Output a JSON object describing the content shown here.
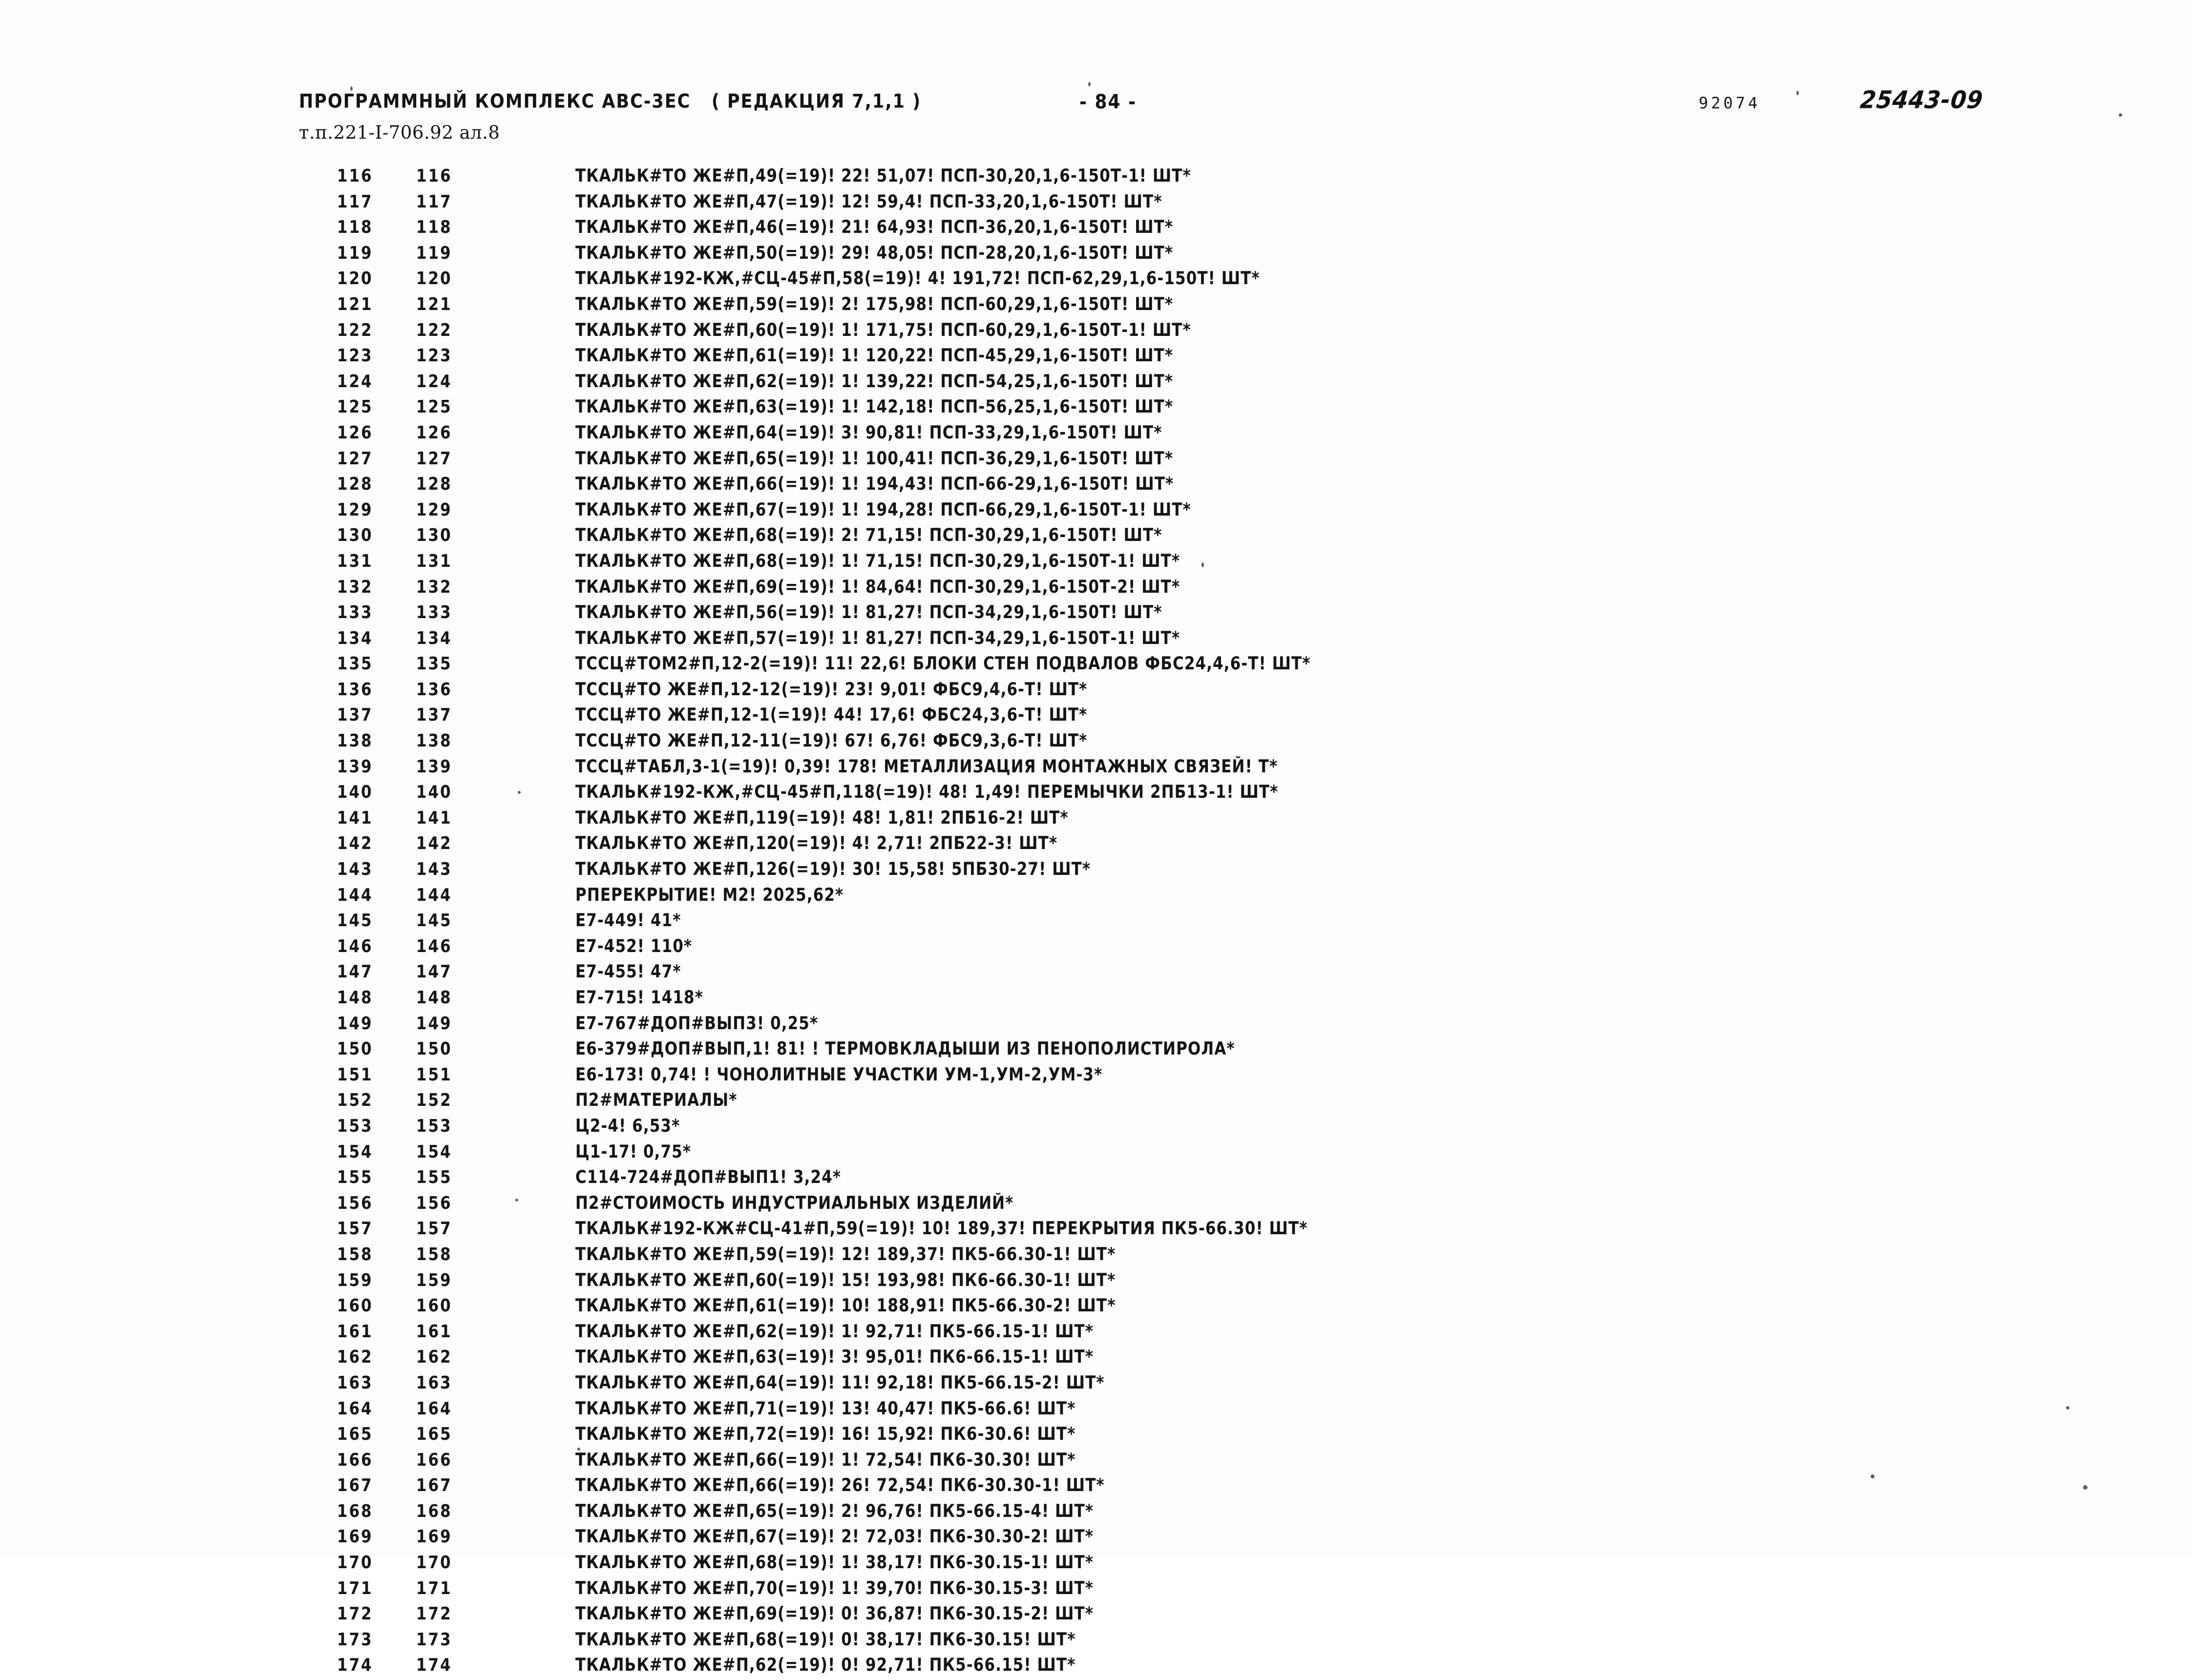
{
  "header": {
    "program_title": "ПРОГРАММНЫЙ КОМПЛЕКС АВС-3ЕС   ( РЕДАКЦИЯ 7,1,1 )",
    "page_number": "- 84 -",
    "document_code": "т.п.221-I-706.92 ал.8",
    "stamp_number": "92074",
    "stamp_code": "25443-09"
  },
  "listing": {
    "rows": [
      {
        "a": "116",
        "b": "116",
        "text": "ТКАЛЬК#ТО ЖЕ#П,49(=19)! 22! 51,07! ПСП-30,20,1,6-150Т-1! ШТ*"
      },
      {
        "a": "117",
        "b": "117",
        "text": "ТКАЛЬК#ТО ЖЕ#П,47(=19)! 12! 59,4! ПСП-33,20,1,6-150Т! ШТ*"
      },
      {
        "a": "118",
        "b": "118",
        "text": "ТКАЛЬК#ТО ЖЕ#П,46(=19)! 21! 64,93! ПСП-36,20,1,6-150Т! ШТ*"
      },
      {
        "a": "119",
        "b": "119",
        "text": "ТКАЛЬК#ТО ЖЕ#П,50(=19)! 29! 48,05! ПСП-28,20,1,6-150Т! ШТ*"
      },
      {
        "a": "120",
        "b": "120",
        "text": "ТКАЛЬК#192-КЖ,#СЦ-45#П,58(=19)! 4! 191,72! ПСП-62,29,1,6-150Т! ШТ*"
      },
      {
        "a": "121",
        "b": "121",
        "text": "ТКАЛЬК#ТО ЖЕ#П,59(=19)! 2! 175,98! ПСП-60,29,1,6-150Т! ШТ*"
      },
      {
        "a": "122",
        "b": "122",
        "text": "ТКАЛЬК#ТО ЖЕ#П,60(=19)! 1! 171,75! ПСП-60,29,1,6-150Т-1! ШТ*"
      },
      {
        "a": "123",
        "b": "123",
        "text": "ТКАЛЬК#ТО ЖЕ#П,61(=19)! 1! 120,22! ПСП-45,29,1,6-150Т! ШТ*"
      },
      {
        "a": "124",
        "b": "124",
        "text": "ТКАЛЬК#ТО ЖЕ#П,62(=19)! 1! 139,22! ПСП-54,25,1,6-150Т! ШТ*"
      },
      {
        "a": "125",
        "b": "125",
        "text": "ТКАЛЬК#ТО ЖЕ#П,63(=19)! 1! 142,18! ПСП-56,25,1,6-150Т! ШТ*"
      },
      {
        "a": "126",
        "b": "126",
        "text": "ТКАЛЬК#ТО ЖЕ#П,64(=19)! 3! 90,81! ПСП-33,29,1,6-150Т! ШТ*"
      },
      {
        "a": "127",
        "b": "127",
        "text": "ТКАЛЬК#ТО ЖЕ#П,65(=19)! 1! 100,41! ПСП-36,29,1,6-150Т! ШТ*"
      },
      {
        "a": "128",
        "b": "128",
        "text": "ТКАЛЬК#ТО ЖЕ#П,66(=19)! 1! 194,43! ПСП-66-29,1,6-150Т! ШТ*"
      },
      {
        "a": "129",
        "b": "129",
        "text": "ТКАЛЬК#ТО ЖЕ#П,67(=19)! 1! 194,28! ПСП-66,29,1,6-150Т-1! ШТ*"
      },
      {
        "a": "130",
        "b": "130",
        "text": "ТКАЛЬК#ТО ЖЕ#П,68(=19)! 2! 71,15! ПСП-30,29,1,6-150Т! ШТ*"
      },
      {
        "a": "131",
        "b": "131",
        "text": "ТКАЛЬК#ТО ЖЕ#П,68(=19)! 1! 71,15! ПСП-30,29,1,6-150Т-1! ШТ*"
      },
      {
        "a": "132",
        "b": "132",
        "text": "ТКАЛЬК#ТО ЖЕ#П,69(=19)! 1! 84,64! ПСП-30,29,1,6-150Т-2! ШТ*"
      },
      {
        "a": "133",
        "b": "133",
        "text": "ТКАЛЬК#ТО ЖЕ#П,56(=19)! 1! 81,27! ПСП-34,29,1,6-150Т! ШТ*"
      },
      {
        "a": "134",
        "b": "134",
        "text": "ТКАЛЬК#ТО ЖЕ#П,57(=19)! 1! 81,27! ПСП-34,29,1,6-150Т-1! ШТ*"
      },
      {
        "a": "135",
        "b": "135",
        "text": "ТССЦ#ТОМ2#П,12-2(=19)! 11! 22,6! БЛОКИ СТЕН ПОДВАЛОВ ФБС24,4,6-Т! ШТ*"
      },
      {
        "a": "136",
        "b": "136",
        "text": "ТССЦ#ТО ЖЕ#П,12-12(=19)! 23! 9,01! ФБС9,4,6-Т! ШТ*"
      },
      {
        "a": "137",
        "b": "137",
        "text": "ТССЦ#ТО ЖЕ#П,12-1(=19)! 44! 17,6! ФБС24,3,6-Т! ШТ*"
      },
      {
        "a": "138",
        "b": "138",
        "text": "ТССЦ#ТО ЖЕ#П,12-11(=19)! 67! 6,76! ФБС9,3,6-Т! ШТ*"
      },
      {
        "a": "139",
        "b": "139",
        "text": "ТССЦ#ТАБЛ,3-1(=19)! 0,39! 178! МЕТАЛЛИЗАЦИЯ МОНТАЖНЫХ СВЯЗЕЙ! Т*"
      },
      {
        "a": "140",
        "b": "140",
        "text": "ТКАЛЬК#192-КЖ,#СЦ-45#П,118(=19)! 48! 1,49! ПЕРЕМЫЧКИ 2ПБ13-1! ШТ*"
      },
      {
        "a": "141",
        "b": "141",
        "text": "ТКАЛЬК#ТО ЖЕ#П,119(=19)! 48! 1,81! 2ПБ16-2! ШТ*"
      },
      {
        "a": "142",
        "b": "142",
        "text": "ТКАЛЬК#ТО ЖЕ#П,120(=19)! 4! 2,71! 2ПБ22-3! ШТ*"
      },
      {
        "a": "143",
        "b": "143",
        "text": "ТКАЛЬК#ТО ЖЕ#П,126(=19)! 30! 15,58! 5ПБ30-27! ШТ*"
      },
      {
        "a": "144",
        "b": "144",
        "text": "РПЕРЕКРЫТИЕ! М2! 2025,62*"
      },
      {
        "a": "145",
        "b": "145",
        "text": "Е7-449! 41*"
      },
      {
        "a": "146",
        "b": "146",
        "text": "Е7-452! 110*"
      },
      {
        "a": "147",
        "b": "147",
        "text": "Е7-455! 47*"
      },
      {
        "a": "148",
        "b": "148",
        "text": "Е7-715! 1418*"
      },
      {
        "a": "149",
        "b": "149",
        "text": "Е7-767#ДОП#ВЫП3! 0,25*"
      },
      {
        "a": "150",
        "b": "150",
        "text": "Е6-379#ДОП#ВЫП,1! 81! ! ТЕРМОВКЛАДЫШИ ИЗ ПЕНОПОЛИСТИРОЛА*"
      },
      {
        "a": "151",
        "b": "151",
        "text": "Е6-173! 0,74! ! ЧОНОЛИТНЫЕ УЧАСТКИ УМ-1,УМ-2,УМ-3*"
      },
      {
        "a": "152",
        "b": "152",
        "text": "П2#МАТЕРИАЛЫ*"
      },
      {
        "a": "153",
        "b": "153",
        "text": "Ц2-4! 6,53*"
      },
      {
        "a": "154",
        "b": "154",
        "text": "Ц1-17! 0,75*"
      },
      {
        "a": "155",
        "b": "155",
        "text": "С114-724#ДОП#ВЫП1! 3,24*"
      },
      {
        "a": "156",
        "b": "156",
        "text": "П2#СТОИМОСТЬ ИНДУСТРИАЛЬНЫХ ИЗДЕЛИЙ*"
      },
      {
        "a": "157",
        "b": "157",
        "text": "ТКАЛЬК#192-КЖ#СЦ-41#П,59(=19)! 10! 189,37! ПЕРЕКРЫТИЯ ПК5-66.30! ШТ*"
      },
      {
        "a": "158",
        "b": "158",
        "text": "ТКАЛЬК#ТО ЖЕ#П,59(=19)! 12! 189,37! ПК5-66.30-1! ШТ*"
      },
      {
        "a": "159",
        "b": "159",
        "text": "ТКАЛЬК#ТО ЖЕ#П,60(=19)! 15! 193,98! ПК6-66.30-1! ШТ*"
      },
      {
        "a": "160",
        "b": "160",
        "text": "ТКАЛЬК#ТО ЖЕ#П,61(=19)! 10! 188,91! ПК5-66.30-2! ШТ*"
      },
      {
        "a": "161",
        "b": "161",
        "text": "ТКАЛЬК#ТО ЖЕ#П,62(=19)! 1! 92,71! ПК5-66.15-1! ШТ*"
      },
      {
        "a": "162",
        "b": "162",
        "text": "ТКАЛЬК#ТО ЖЕ#П,63(=19)! 3! 95,01! ПК6-66.15-1! ШТ*"
      },
      {
        "a": "163",
        "b": "163",
        "text": "ТКАЛЬК#ТО ЖЕ#П,64(=19)! 11! 92,18! ПК5-66.15-2! ШТ*"
      },
      {
        "a": "164",
        "b": "164",
        "text": "ТКАЛЬК#ТО ЖЕ#П,71(=19)! 13! 40,47! ПК5-66.6! ШТ*"
      },
      {
        "a": "165",
        "b": "165",
        "text": "ТКАЛЬК#ТО ЖЕ#П,72(=19)! 16! 15,92! ПК6-30.6! ШТ*"
      },
      {
        "a": "166",
        "b": "166",
        "text": "ТКАЛЬК#ТО ЖЕ#П,66(=19)! 1! 72,54! ПК6-30.30! ШТ*"
      },
      {
        "a": "167",
        "b": "167",
        "text": "ТКАЛЬК#ТО ЖЕ#П,66(=19)! 26! 72,54! ПК6-30.30-1! ШТ*"
      },
      {
        "a": "168",
        "b": "168",
        "text": "ТКАЛЬК#ТО ЖЕ#П,65(=19)! 2! 96,76! ПК5-66.15-4! ШТ*"
      },
      {
        "a": "169",
        "b": "169",
        "text": "ТКАЛЬК#ТО ЖЕ#П,67(=19)! 2! 72,03! ПК6-30.30-2! ШТ*"
      },
      {
        "a": "170",
        "b": "170",
        "text": "ТКАЛЬК#ТО ЖЕ#П,68(=19)! 1! 38,17! ПК6-30.15-1! ШТ*"
      },
      {
        "a": "171",
        "b": "171",
        "text": "ТКАЛЬК#ТО ЖЕ#П,70(=19)! 1! 39,70! ПК6-30.15-3! ШТ*"
      },
      {
        "a": "172",
        "b": "172",
        "text": "ТКАЛЬК#ТО ЖЕ#П,69(=19)! 0! 36,87! ПК6-30.15-2! ШТ*"
      },
      {
        "a": "173",
        "b": "173",
        "text": "ТКАЛЬК#ТО ЖЕ#П,68(=19)! 0! 38,17! ПК6-30.15! ШТ*"
      },
      {
        "a": "174",
        "b": "174",
        "text": "ТКАЛЬК#ТО ЖЕ#П,62(=19)! 0! 92,71! ПК5-66.15! ШТ*"
      }
    ]
  }
}
